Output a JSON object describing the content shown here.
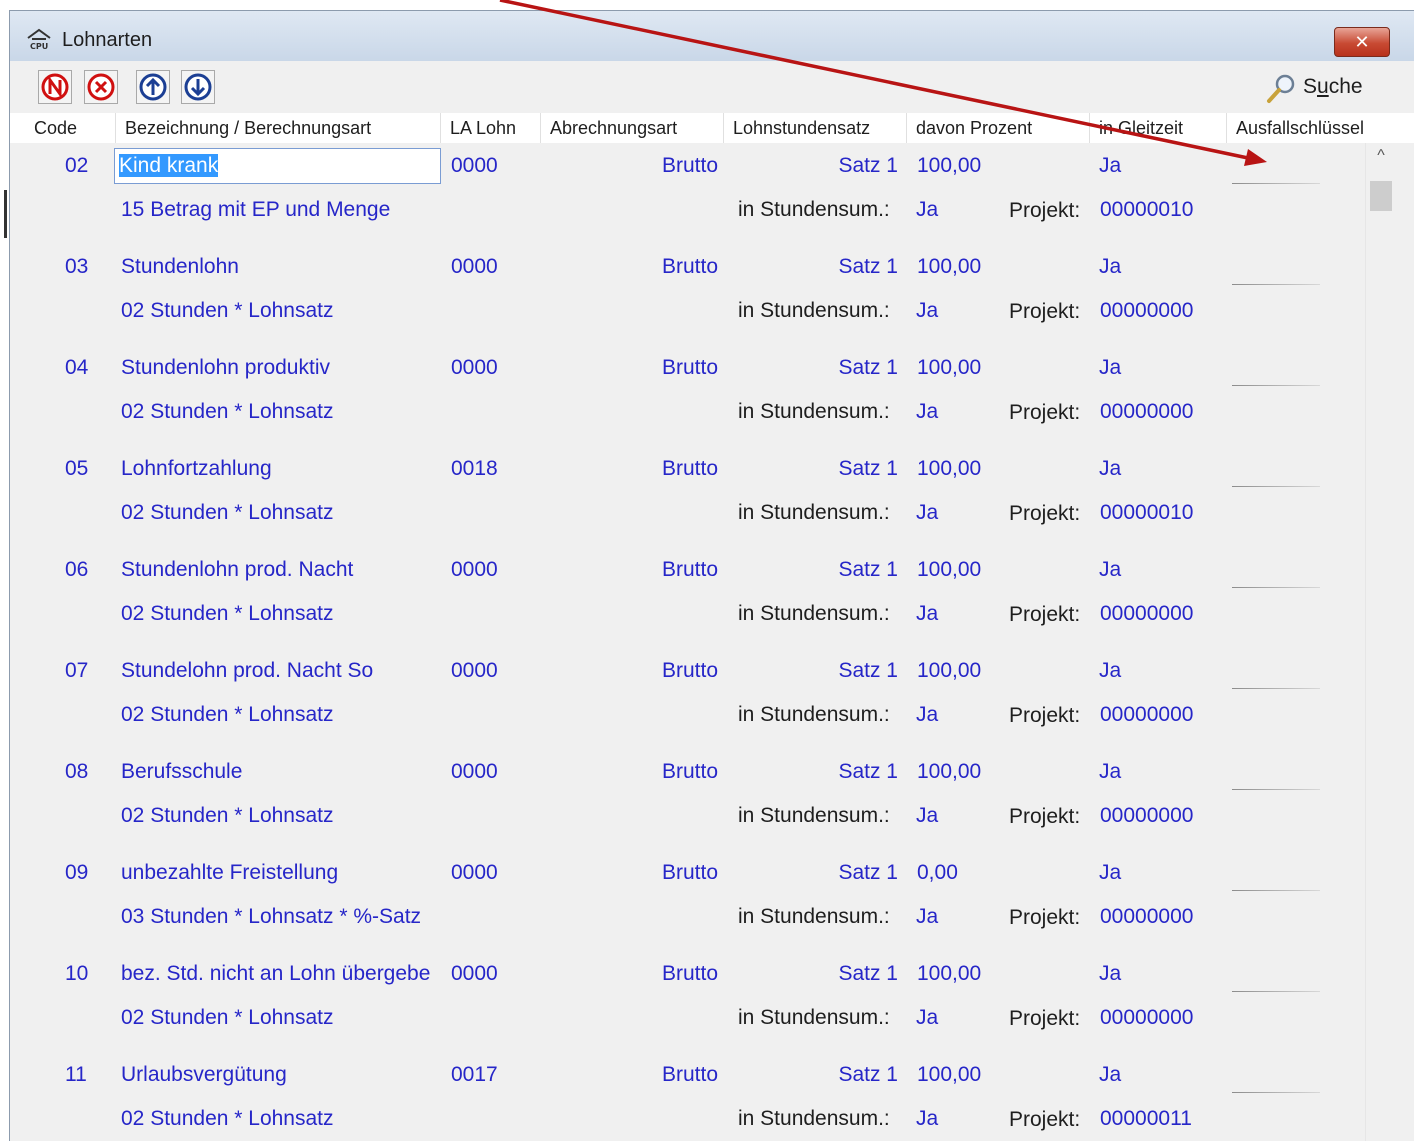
{
  "window": {
    "title": "Lohnarten",
    "close_symbol": "✕",
    "app_icon": "cpu-house-icon"
  },
  "toolbar": {
    "buttons": [
      {
        "name": "new-button",
        "icon": "n-circle-icon"
      },
      {
        "name": "delete-button",
        "icon": "x-circle-icon"
      },
      {
        "name": "move-up-button",
        "icon": "arrow-up-circle-icon"
      },
      {
        "name": "move-down-button",
        "icon": "arrow-down-circle-icon"
      }
    ],
    "search": {
      "label_pre": "S",
      "label_underlined": "u",
      "label_post": "che",
      "icon": "magnifier-icon"
    }
  },
  "columns": [
    "Code",
    "Bezeichnung / Berechnungsart",
    "LA Lohn",
    "Abrechnungsart",
    "Lohnstundensatz",
    "davon Prozent",
    "in Gleitzeit",
    "Ausfallschlüssel"
  ],
  "labels": {
    "stunden": "in Stundensum.:",
    "projekt": "Projekt:"
  },
  "rows": [
    {
      "code": "02",
      "bezeichnung": "Kind krank",
      "la": "0000",
      "abrechnung": "Brutto",
      "satz": "Satz 1",
      "prozent": "100,00",
      "gleitzeit": "Ja",
      "berechnung": "15 Betrag mit EP und Menge",
      "stunden": "Ja",
      "projekt": "00000010"
    },
    {
      "code": "03",
      "bezeichnung": "Stundenlohn",
      "la": "0000",
      "abrechnung": "Brutto",
      "satz": "Satz 1",
      "prozent": "100,00",
      "gleitzeit": "Ja",
      "berechnung": "02 Stunden * Lohnsatz",
      "stunden": "Ja",
      "projekt": "00000000"
    },
    {
      "code": "04",
      "bezeichnung": "Stundenlohn produktiv",
      "la": "0000",
      "abrechnung": "Brutto",
      "satz": "Satz 1",
      "prozent": "100,00",
      "gleitzeit": "Ja",
      "berechnung": "02 Stunden * Lohnsatz",
      "stunden": "Ja",
      "projekt": "00000000"
    },
    {
      "code": "05",
      "bezeichnung": "Lohnfortzahlung",
      "la": "0018",
      "abrechnung": "Brutto",
      "satz": "Satz 1",
      "prozent": "100,00",
      "gleitzeit": "Ja",
      "berechnung": "02 Stunden * Lohnsatz",
      "stunden": "Ja",
      "projekt": "00000010"
    },
    {
      "code": "06",
      "bezeichnung": "Stundenlohn prod. Nacht",
      "la": "0000",
      "abrechnung": "Brutto",
      "satz": "Satz 1",
      "prozent": "100,00",
      "gleitzeit": "Ja",
      "berechnung": "02 Stunden * Lohnsatz",
      "stunden": "Ja",
      "projekt": "00000000"
    },
    {
      "code": "07",
      "bezeichnung": "Stundelohn prod. Nacht So",
      "la": "0000",
      "abrechnung": "Brutto",
      "satz": "Satz 1",
      "prozent": "100,00",
      "gleitzeit": "Ja",
      "berechnung": "02 Stunden * Lohnsatz",
      "stunden": "Ja",
      "projekt": "00000000"
    },
    {
      "code": "08",
      "bezeichnung": "Berufsschule",
      "la": "0000",
      "abrechnung": "Brutto",
      "satz": "Satz 1",
      "prozent": "100,00",
      "gleitzeit": "Ja",
      "berechnung": "02 Stunden * Lohnsatz",
      "stunden": "Ja",
      "projekt": "00000000"
    },
    {
      "code": "09",
      "bezeichnung": "unbezahlte Freistellung",
      "la": "0000",
      "abrechnung": "Brutto",
      "satz": "Satz 1",
      "prozent": "0,00",
      "gleitzeit": "Ja",
      "berechnung": "03 Stunden * Lohnsatz * %-Satz",
      "stunden": "Ja",
      "projekt": "00000000"
    },
    {
      "code": "10",
      "bezeichnung": "bez. Std. nicht an Lohn übergebe",
      "la": "0000",
      "abrechnung": "Brutto",
      "satz": "Satz 1",
      "prozent": "100,00",
      "gleitzeit": "Ja",
      "berechnung": "02 Stunden * Lohnsatz",
      "stunden": "Ja",
      "projekt": "00000000"
    },
    {
      "code": "11",
      "bezeichnung": "Urlaubsvergütung",
      "la": "0017",
      "abrechnung": "Brutto",
      "satz": "Satz 1",
      "prozent": "100,00",
      "gleitzeit": "Ja",
      "berechnung": "02 Stunden * Lohnsatz",
      "stunden": "Ja",
      "projekt": "00000011"
    }
  ],
  "scrollbar": {
    "up_symbol": "^"
  },
  "colors": {
    "value_text": "#2626c8",
    "label_text": "#1e1e1e",
    "annotation_arrow": "#b81414",
    "selection": "#3399ff"
  }
}
